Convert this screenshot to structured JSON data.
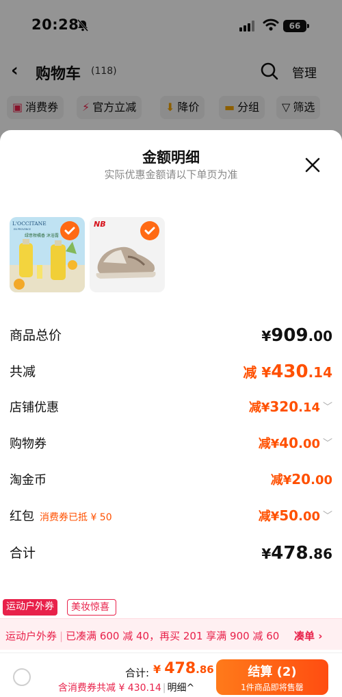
{
  "status": {
    "time": "20:28",
    "battery": "66"
  },
  "nav": {
    "title": "购物车",
    "count": "(118)",
    "manage": "管理"
  },
  "filters": [
    "消费券",
    "官方立减",
    "降价",
    "分组",
    "筛选"
  ],
  "sheet": {
    "title": "金额明细",
    "subtitle": "实际优惠金额请以下单页为准",
    "products": [
      {
        "name": "L'OCCITANE",
        "brand_sub": "EN PROVENCE",
        "promo_text": "绿意柑橘香 沐浴露"
      },
      {
        "name": "New Balance sneaker"
      }
    ],
    "rows": {
      "subtotal": {
        "label": "商品总价",
        "yen": "¥",
        "int": "909",
        "dec": ".00"
      },
      "total_discount": {
        "label": "共减",
        "prefix": "减 ¥",
        "int": "430",
        "dec": ".14"
      },
      "shop": {
        "label": "店铺优惠",
        "prefix": "减¥",
        "int": "320",
        "dec": ".14"
      },
      "coupon": {
        "label": "购物券",
        "prefix": "减¥",
        "int": "40",
        "dec": ".00"
      },
      "coin": {
        "label": "淘金币",
        "prefix": "减¥",
        "int": "20",
        "dec": ".00"
      },
      "redpacket": {
        "label": "红包",
        "note": "消费券已抵 ¥ 50",
        "prefix": "减¥",
        "int": "50",
        "dec": ".00"
      },
      "total": {
        "label": "合计",
        "yen": "¥",
        "int": "478",
        "dec": ".86"
      }
    }
  },
  "promo": {
    "tag1": "运动户外券",
    "tag2": "美妆惊喜",
    "name": "运动户外券",
    "text": "已凑满 600 减 40，再买 201 享满 900 减 60",
    "link": "凑单 ›"
  },
  "bottom": {
    "total_label": "合计:",
    "yen": "¥",
    "total_int": "478",
    "total_dec": ".86",
    "saving": "含消费券共减 ¥ 430.14",
    "detail": "明细^",
    "checkout": "结算 (2)",
    "checkout_sub": "1件商品即将售罄"
  },
  "colors": {
    "accent": "#ff5000",
    "promo": "#e8214a",
    "overlay": "rgba(0,0,0,0.42)"
  }
}
